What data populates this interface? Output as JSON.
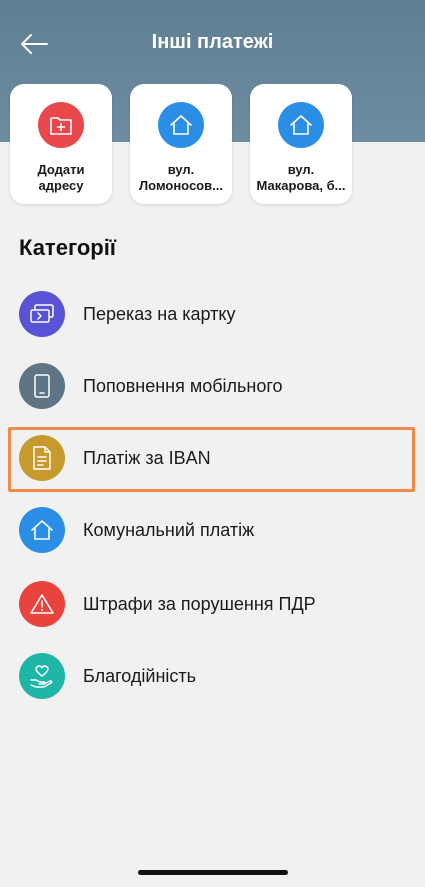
{
  "header": {
    "title": "Інші платежі"
  },
  "cards": [
    {
      "line1": "Додати",
      "line2": "адресу",
      "icon": "folder-plus-icon",
      "color": "#e8474c"
    },
    {
      "line1": "вул.",
      "line2": "Ломоносов...",
      "icon": "home-icon",
      "color": "#2b8ee6"
    },
    {
      "line1": "вул.",
      "line2": "Макарова, б...",
      "icon": "home-icon",
      "color": "#2b8ee6"
    }
  ],
  "categories": {
    "title": "Категорії",
    "items": [
      {
        "label": "Переказ на картку",
        "icon": "card-transfer-icon",
        "color": "#5b53d6"
      },
      {
        "label": "Поповнення мобільного",
        "icon": "mobile-phone-icon",
        "color": "#5f7484"
      },
      {
        "label": "Платіж за IBAN",
        "icon": "document-icon",
        "color": "#c69a2c",
        "highlighted": true
      },
      {
        "label": "Комунальний платіж",
        "icon": "home-icon",
        "color": "#2b8ee6"
      },
      {
        "label": "Штрафи за порушення ПДР",
        "icon": "warning-icon",
        "color": "#e8433c"
      },
      {
        "label": "Благодійність",
        "icon": "charity-heart-icon",
        "color": "#1fb6a8"
      }
    ]
  }
}
